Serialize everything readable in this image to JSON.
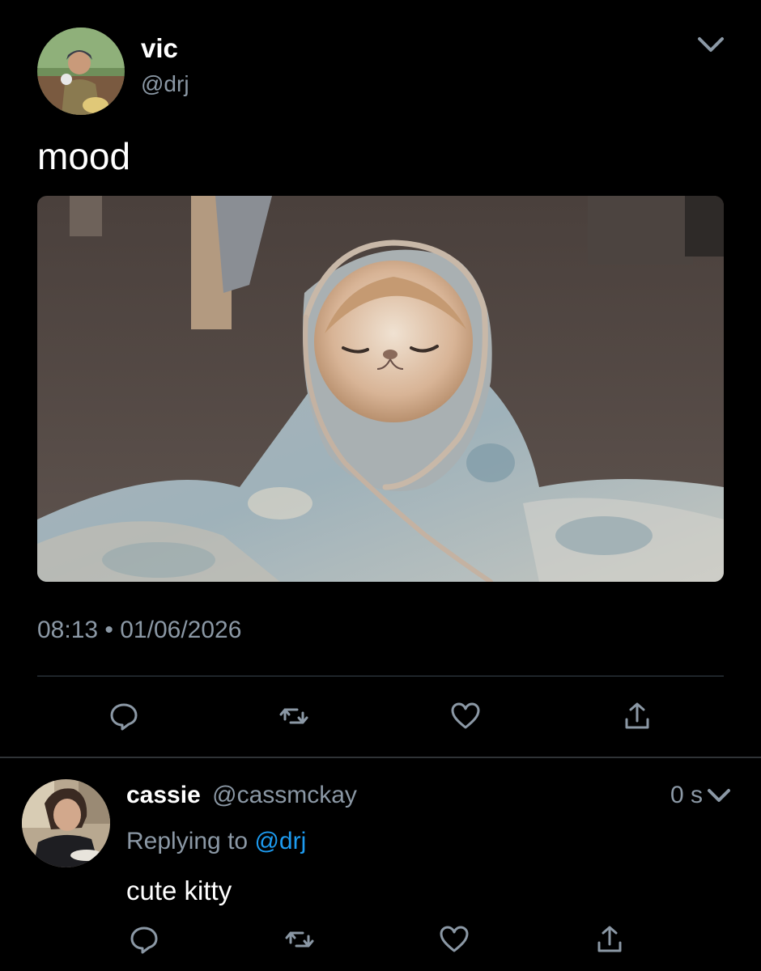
{
  "tweet": {
    "author": {
      "display_name": "vic",
      "handle": "@drj"
    },
    "text": "mood",
    "media_alt": "cat wrapped in a blanket",
    "timestamp": "08:13 • 01/06/2026"
  },
  "reply": {
    "author": {
      "display_name": "cassie",
      "handle": "@cassmckay"
    },
    "time": "0 s",
    "replying_label": "Replying to",
    "replying_to": "@drj",
    "text": "cute kitty"
  },
  "icons": {
    "reply": "speech-bubble-icon",
    "retweet": "retweet-icon",
    "like": "heart-icon",
    "share": "share-icon",
    "menu": "chevron-down-icon"
  },
  "colors": {
    "background": "#000000",
    "text_primary": "#ffffff",
    "text_secondary": "#8b98a5",
    "accent": "#1d9bf0",
    "divider": "#38444d"
  }
}
